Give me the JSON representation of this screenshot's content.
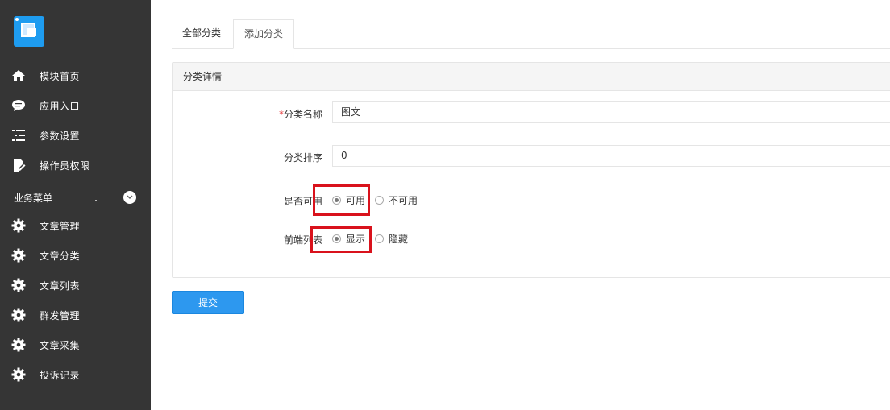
{
  "sidebar": {
    "items": [
      {
        "label": "模块首页",
        "icon": "home-icon"
      },
      {
        "label": "应用入口",
        "icon": "chat-bubble-icon"
      },
      {
        "label": "参数设置",
        "icon": "list-settings-icon"
      },
      {
        "label": "操作员权限",
        "icon": "edit-document-icon"
      }
    ],
    "group": {
      "label": "业务菜单",
      "icon": "chevron-down-icon"
    },
    "group_items": [
      {
        "label": "文章管理",
        "icon": "gear-icon"
      },
      {
        "label": "文章分类",
        "icon": "gear-icon"
      },
      {
        "label": "文章列表",
        "icon": "gear-icon"
      },
      {
        "label": "群发管理",
        "icon": "gear-icon"
      },
      {
        "label": "文章采集",
        "icon": "gear-icon"
      },
      {
        "label": "投诉记录",
        "icon": "gear-icon"
      }
    ]
  },
  "tabs": [
    {
      "label": "全部分类",
      "active": false
    },
    {
      "label": "添加分类",
      "active": true
    }
  ],
  "panel": {
    "title": "分类详情",
    "fields": {
      "name": {
        "required_mark": "*",
        "label": "分类名称",
        "value": "图文"
      },
      "sort": {
        "label": "分类排序",
        "value": "0"
      },
      "enabled": {
        "label": "是否可用",
        "options": [
          "可用",
          "不可用"
        ],
        "selected": "可用"
      },
      "frontend": {
        "label": "前端列表",
        "options": [
          "显示",
          "隐藏"
        ],
        "selected": "显示"
      }
    }
  },
  "submit_label": "提交",
  "colors": {
    "sidebar_bg": "#353535",
    "primary_button": "#2d98ef",
    "highlight_box": "#d9121c",
    "required_mark": "#e4393c"
  }
}
